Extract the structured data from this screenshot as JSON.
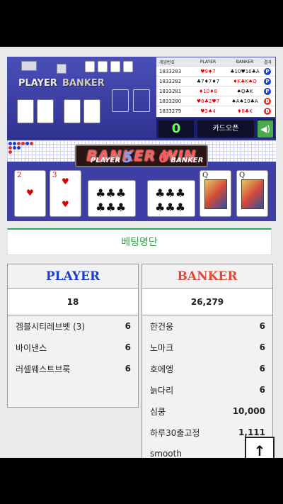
{
  "history": {
    "headers": [
      "게임번호",
      "PLAYER",
      "BANKER",
      "결과"
    ],
    "rows": [
      {
        "id": "1833283",
        "player": "♥9♦7",
        "banker": "♣10♥10♣A",
        "result": "P"
      },
      {
        "id": "1833282",
        "player": "♣7♦7♦7",
        "banker": "♦K♣K♠Q",
        "result": "P"
      },
      {
        "id": "1833281",
        "player": "♦10♦8",
        "banker": "♠Q♣K",
        "result": "P"
      },
      {
        "id": "1833280",
        "player": "♥8♣2♥7",
        "banker": "♠A♠10♣A",
        "result": "B"
      },
      {
        "id": "1833279",
        "player": "♥3♠4",
        "banker": "♦8♣K",
        "result": "B"
      }
    ]
  },
  "controls": {
    "score": "0",
    "open_cards_label": "카드오픈",
    "sound_icon": "speaker-icon"
  },
  "table": {
    "player_label": "PLAYER",
    "banker_label": "BANKER",
    "result_banner": "BANKER WIN",
    "player_score_label": "PLAYER",
    "player_score": "5",
    "banker_score_label": "BANKER",
    "banker_score": "6",
    "player_cards": [
      "2",
      "3",
      "",
      "♣"
    ],
    "banker_cards": [
      "",
      "Q",
      "Q"
    ]
  },
  "colors": {
    "player_blue": "#1a3fd0",
    "banker_red": "#e04a3a",
    "accent_green": "#2ea84a"
  },
  "betting": {
    "title": "베팅명단",
    "player": {
      "heading": "PLAYER",
      "total": "18",
      "rows": [
        {
          "name": "겜블시티레브벳 (3)",
          "amount": "6"
        },
        {
          "name": "바이낸스",
          "amount": "6"
        },
        {
          "name": "러셀웨스트브룩",
          "amount": "6"
        }
      ]
    },
    "banker": {
      "heading": "BANKER",
      "total": "26,279",
      "rows": [
        {
          "name": "한건웅",
          "amount": "6"
        },
        {
          "name": "노마크",
          "amount": "6"
        },
        {
          "name": "호에엥",
          "amount": "6"
        },
        {
          "name": "늙다리",
          "amount": "6"
        },
        {
          "name": "심쿵",
          "amount": "10,000"
        },
        {
          "name": "하루30출고정",
          "amount": "1,111"
        },
        {
          "name": "smooth",
          "amount": ""
        }
      ]
    }
  },
  "scroll_top_label": "↑"
}
